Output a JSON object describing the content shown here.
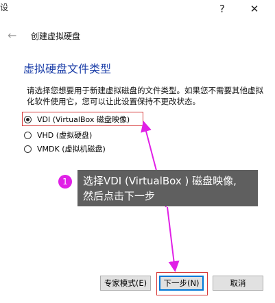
{
  "titlebar": {
    "left_stub": "设",
    "help": "?",
    "close": "✕"
  },
  "wizard": {
    "back_icon": "←",
    "title": "创建虚拟硬盘",
    "heading": "虚拟硬盘文件类型",
    "description": "请选择您想要用于新建虚拟磁盘的文件类型。如果您不需要其他虚拟化软件使用它，您可以让此设置保持不更改状态。",
    "options": [
      {
        "label": "VDI (VirtualBox 磁盘映像)",
        "selected": true
      },
      {
        "label": "VHD (虚拟硬盘)",
        "selected": false
      },
      {
        "label": "VMDK (虚拟机磁盘)",
        "selected": false
      }
    ]
  },
  "annotation": {
    "badge": "1",
    "line1": "选择VDI (VirtualBox ) 磁盘映像,",
    "line2": "然后点击下一步",
    "color": "#e020e6"
  },
  "buttons": {
    "expert": "专家模式(E)",
    "next": "下一步(N)",
    "cancel": "取消"
  },
  "colors": {
    "heading": "#1b3ea8",
    "highlight": "#d63a3a",
    "tooltip_bg": "#5f5f5f"
  }
}
